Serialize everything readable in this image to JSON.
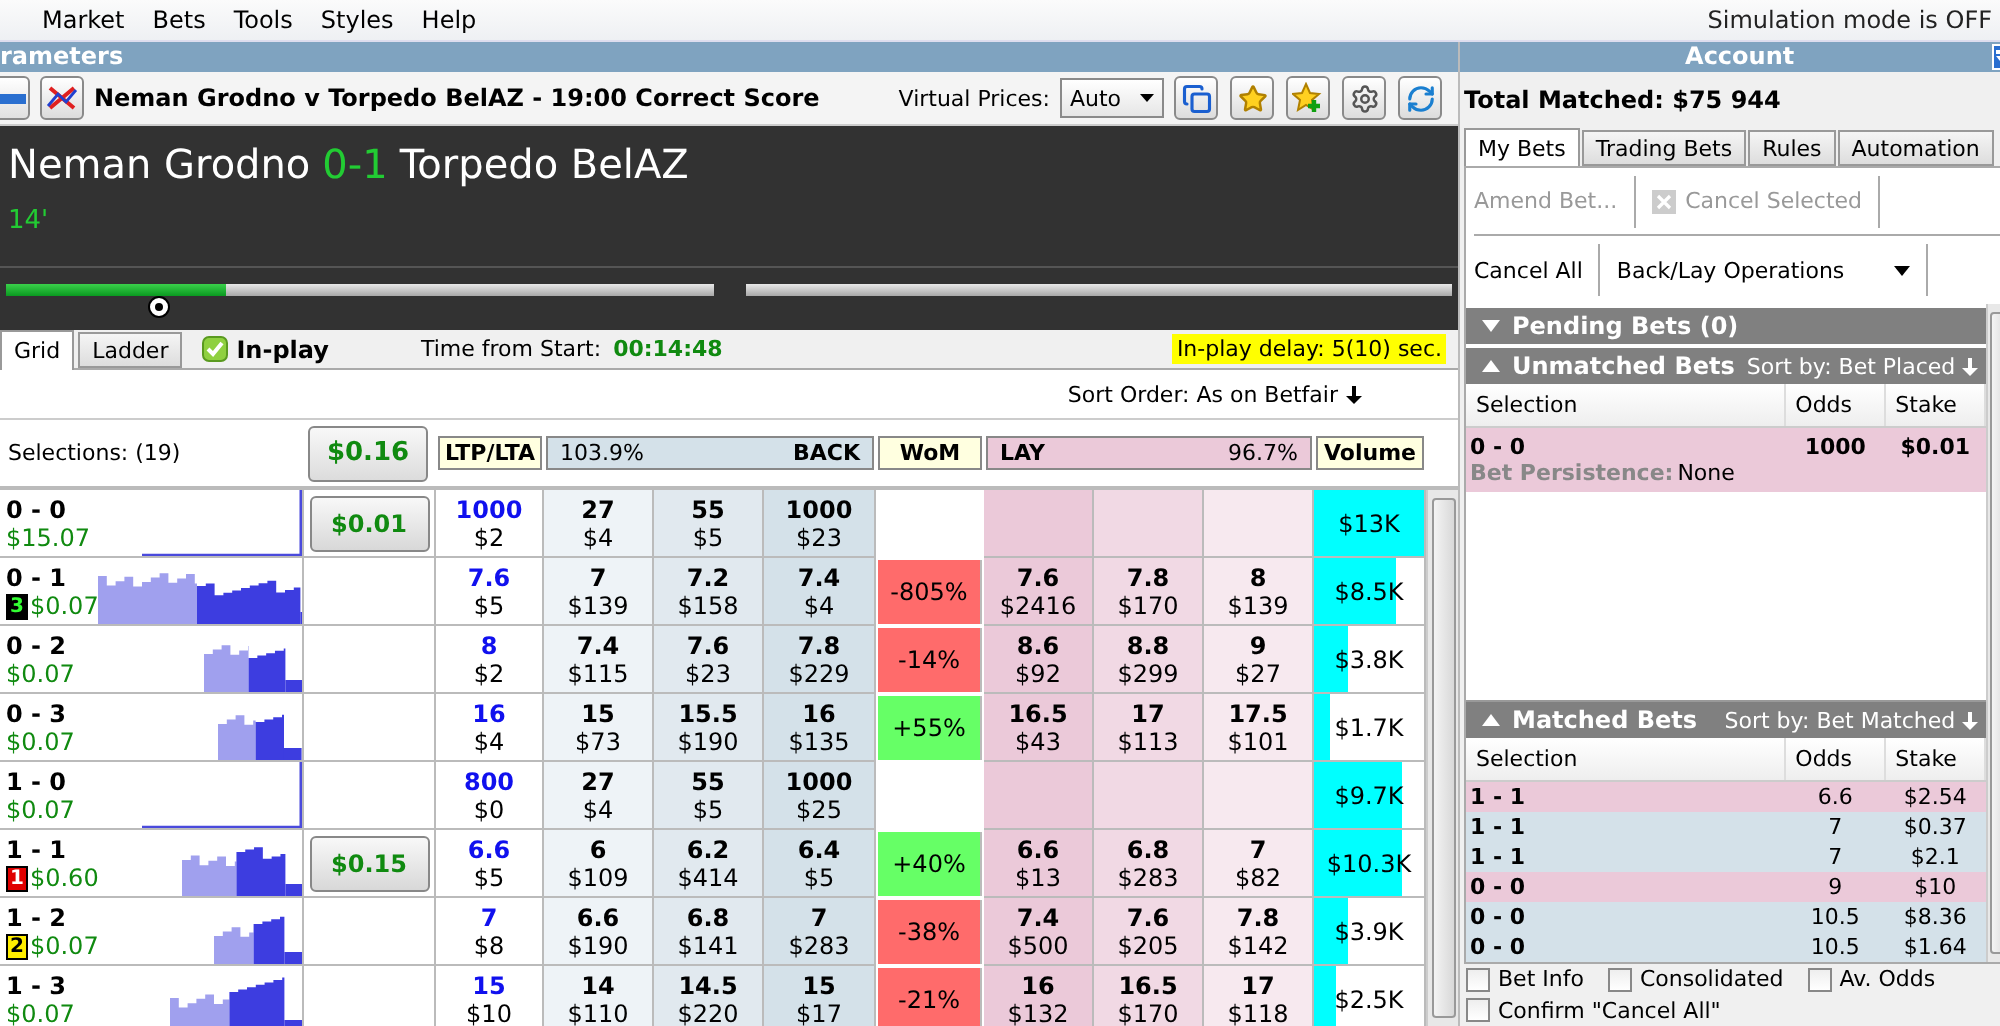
{
  "menu": [
    "Market",
    "Bets",
    "Tools",
    "Styles",
    "Help"
  ],
  "simulation_status": "Simulation mode is OFF",
  "left_title": "rameters",
  "market_title": "Neman Grodno v Torpedo BelAZ - 19:00 Correct Score",
  "virtual_prices": {
    "label": "Virtual Prices:",
    "value": "Auto"
  },
  "score": {
    "home": "Neman Grodno",
    "score": "0-1",
    "away": "Torpedo BelAZ",
    "minute": "14'"
  },
  "match_progress": {
    "level": 0.31
  },
  "view_tabs": [
    {
      "label": "Grid",
      "selected": true
    },
    {
      "label": "Ladder",
      "selected": false
    }
  ],
  "in_play": {
    "label": "In-play",
    "checked": true
  },
  "time_from_start": {
    "label": "Time from Start:",
    "value": "00:14:48"
  },
  "in_play_delay": "In-play delay: 5(10) sec.",
  "sort_order": "Sort Order: As on Betfair",
  "grid_header": {
    "selections": "Selections: (19)",
    "total_button": "$0.16",
    "ltp": "LTP/LTA",
    "back_percent": "103.9%",
    "back": "BACK",
    "wom": "WoM",
    "lay": "LAY",
    "lay_percent": "96.7%",
    "volume": "Volume"
  },
  "rows": [
    {
      "name": "0 - 0",
      "pl": "$15.07",
      "button": "$0.01",
      "ltp": "1000",
      "lta": "$2",
      "back": [
        {
          "odds": "27",
          "amount": "$4"
        },
        {
          "odds": "55",
          "amount": "$5"
        },
        {
          "odds": "1000",
          "amount": "$23"
        }
      ],
      "lay": [],
      "volume": {
        "text": "$13K",
        "level": 1
      }
    },
    {
      "name": "0 - 1",
      "badge": {
        "text": "3",
        "color": "#000000"
      },
      "pl": "$0.07",
      "ltp": "7.6",
      "lta": "$5",
      "back": [
        {
          "odds": "7",
          "amount": "$139"
        },
        {
          "odds": "7.2",
          "amount": "$158"
        },
        {
          "odds": "7.4",
          "amount": "$4"
        }
      ],
      "wom": {
        "text": "-805%",
        "kind": "negative"
      },
      "lay": [
        {
          "odds": "7.6",
          "amount": "$2416"
        },
        {
          "odds": "7.8",
          "amount": "$170"
        },
        {
          "odds": "8",
          "amount": "$139"
        }
      ],
      "volume": {
        "text": "$8.5K",
        "level": 0.74
      }
    },
    {
      "name": "0 - 2",
      "pl": "$0.07",
      "ltp": "8",
      "lta": "$2",
      "back": [
        {
          "odds": "7.4",
          "amount": "$115"
        },
        {
          "odds": "7.6",
          "amount": "$23"
        },
        {
          "odds": "7.8",
          "amount": "$229"
        }
      ],
      "wom": {
        "text": "-14%",
        "kind": "negative"
      },
      "lay": [
        {
          "odds": "8.6",
          "amount": "$92"
        },
        {
          "odds": "8.8",
          "amount": "$299"
        },
        {
          "odds": "9",
          "amount": "$27"
        }
      ],
      "volume": {
        "text": "$3.8K",
        "level": 0.3
      }
    },
    {
      "name": "0 - 3",
      "pl": "$0.07",
      "ltp": "16",
      "lta": "$4",
      "back": [
        {
          "odds": "15",
          "amount": "$73"
        },
        {
          "odds": "15.5",
          "amount": "$190"
        },
        {
          "odds": "16",
          "amount": "$135"
        }
      ],
      "wom": {
        "text": "+55%",
        "kind": "positive"
      },
      "lay": [
        {
          "odds": "16.5",
          "amount": "$43"
        },
        {
          "odds": "17",
          "amount": "$113"
        },
        {
          "odds": "17.5",
          "amount": "$101"
        }
      ],
      "volume": {
        "text": "$1.7K",
        "level": 0.14
      }
    },
    {
      "name": "1 - 0",
      "pl": "$0.07",
      "ltp": "800",
      "lta": "$0",
      "back": [
        {
          "odds": "27",
          "amount": "$4"
        },
        {
          "odds": "55",
          "amount": "$5"
        },
        {
          "odds": "1000",
          "amount": "$25"
        }
      ],
      "lay": [],
      "volume": {
        "text": "$9.7K",
        "level": 0.8
      }
    },
    {
      "name": "1 - 1",
      "badge": {
        "text": "1",
        "color": "#e00000"
      },
      "pl": "$0.60",
      "button": "$0.15",
      "ltp": "6.6",
      "lta": "$5",
      "back": [
        {
          "odds": "6",
          "amount": "$109"
        },
        {
          "odds": "6.2",
          "amount": "$414"
        },
        {
          "odds": "6.4",
          "amount": "$5"
        }
      ],
      "wom": {
        "text": "+40%",
        "kind": "positive"
      },
      "lay": [
        {
          "odds": "6.6",
          "amount": "$13"
        },
        {
          "odds": "6.8",
          "amount": "$283"
        },
        {
          "odds": "7",
          "amount": "$82"
        }
      ],
      "volume": {
        "text": "$10.3K",
        "level": 0.8
      }
    },
    {
      "name": "1 - 2",
      "badge": {
        "text": "2",
        "color": "#ffee00"
      },
      "pl": "$0.07",
      "ltp": "7",
      "lta": "$8",
      "back": [
        {
          "odds": "6.6",
          "amount": "$190"
        },
        {
          "odds": "6.8",
          "amount": "$141"
        },
        {
          "odds": "7",
          "amount": "$283"
        }
      ],
      "wom": {
        "text": "-38%",
        "kind": "negative"
      },
      "lay": [
        {
          "odds": "7.4",
          "amount": "$500"
        },
        {
          "odds": "7.6",
          "amount": "$205"
        },
        {
          "odds": "7.8",
          "amount": "$142"
        }
      ],
      "volume": {
        "text": "$3.9K",
        "level": 0.3
      }
    },
    {
      "name": "1 - 3",
      "pl": "$0.07",
      "ltp": "15",
      "lta": "$10",
      "back": [
        {
          "odds": "14",
          "amount": "$110"
        },
        {
          "odds": "14.5",
          "amount": "$220"
        },
        {
          "odds": "15",
          "amount": "$17"
        }
      ],
      "wom": {
        "text": "-21%",
        "kind": "negative"
      },
      "lay": [
        {
          "odds": "16",
          "amount": "$132"
        },
        {
          "odds": "16.5",
          "amount": "$170"
        },
        {
          "odds": "17",
          "amount": "$118"
        }
      ],
      "volume": {
        "text": "$2.5K",
        "level": 0.2
      }
    }
  ],
  "account": {
    "title": "Account",
    "total_matched": "Total Matched: $75 944",
    "tabs": [
      {
        "label": "My Bets",
        "selected": true
      },
      {
        "label": "Trading Bets",
        "selected": false
      },
      {
        "label": "Rules",
        "selected": false
      },
      {
        "label": "Automation",
        "selected": false
      }
    ],
    "action_rows": [
      {
        "actions": [
          {
            "label": "Amend Bet...",
            "disabled": true,
            "kind": "button"
          },
          {
            "label": "Cancel Selected",
            "disabled": true,
            "kind": "icon_button"
          }
        ]
      },
      {
        "actions": [
          {
            "label": "Cancel All",
            "disabled": false,
            "kind": "button"
          },
          {
            "label": "Back/Lay Operations",
            "disabled": false,
            "kind": "dropdown"
          }
        ]
      }
    ],
    "pending": {
      "title": "Pending Bets (0)",
      "expanded": false
    },
    "unmatched": {
      "title": "Unmatched Bets",
      "expanded": true,
      "sort": "Sort by: Bet Placed",
      "columns": [
        "Selection",
        "Odds",
        "Stake"
      ],
      "bets": [
        {
          "selection": "0 - 0",
          "odds": "1000",
          "stake": "$0.01",
          "kind": "lay",
          "persistence_label": "Bet Persistence:",
          "persistence": "None"
        }
      ]
    },
    "matched": {
      "title": "Matched Bets",
      "expanded": true,
      "sort": "Sort by: Bet Matched",
      "columns": [
        "Selection",
        "Odds",
        "Stake"
      ],
      "bets": [
        {
          "selection": "1 - 1",
          "odds": "6.6",
          "stake": "$2.54",
          "kind": "lay"
        },
        {
          "selection": "1 - 1",
          "odds": "7",
          "stake": "$0.37",
          "kind": "back"
        },
        {
          "selection": "1 - 1",
          "odds": "7",
          "stake": "$2.1",
          "kind": "back"
        },
        {
          "selection": "0 - 0",
          "odds": "9",
          "stake": "$10",
          "kind": "lay"
        },
        {
          "selection": "0 - 0",
          "odds": "10.5",
          "stake": "$8.36",
          "kind": "back"
        },
        {
          "selection": "0 - 0",
          "odds": "10.5",
          "stake": "$1.64",
          "kind": "back"
        }
      ]
    },
    "options": [
      {
        "label": "Bet Info",
        "checked": false
      },
      {
        "label": "Consolidated",
        "checked": false
      },
      {
        "label": "Av. Odds",
        "checked": false
      },
      {
        "label": "Confirm \"Cancel All\"",
        "checked": false
      }
    ]
  }
}
